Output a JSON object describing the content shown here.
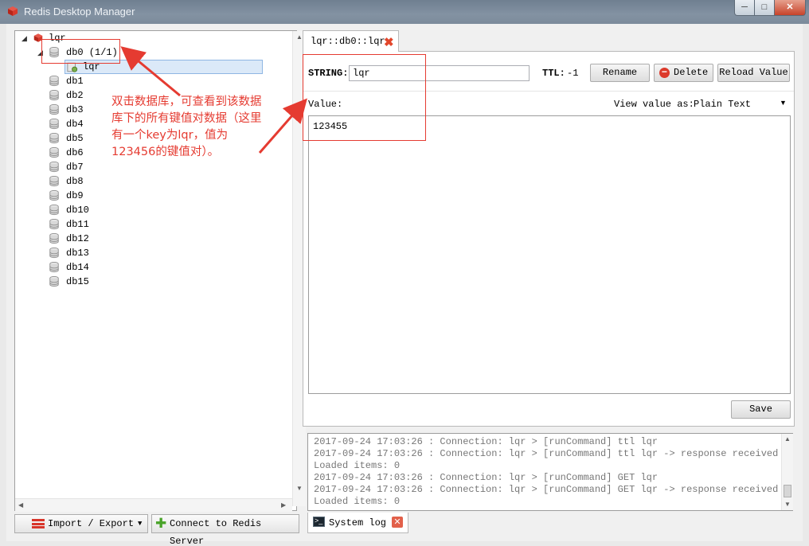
{
  "window": {
    "title": "Redis Desktop Manager",
    "controls": {
      "minimize": "─",
      "maximize": "□",
      "close": "✕"
    }
  },
  "tree": {
    "connection": {
      "label": "lqr",
      "icon": "redis-server-icon"
    },
    "databases": [
      {
        "label": "db0 (1/1)",
        "expanded": true,
        "keys": [
          {
            "label": "lqr",
            "selected": true
          }
        ]
      },
      {
        "label": "db1"
      },
      {
        "label": "db2"
      },
      {
        "label": "db3"
      },
      {
        "label": "db4"
      },
      {
        "label": "db5"
      },
      {
        "label": "db6"
      },
      {
        "label": "db7"
      },
      {
        "label": "db8"
      },
      {
        "label": "db9"
      },
      {
        "label": "db10"
      },
      {
        "label": "db11"
      },
      {
        "label": "db12"
      },
      {
        "label": "db13"
      },
      {
        "label": "db14"
      },
      {
        "label": "db15"
      }
    ]
  },
  "bottom_left": {
    "import_export_label": "Import / Export",
    "connect_label": "Connect to Redis Server"
  },
  "key_tab": {
    "label": "lqr::db0::lqr"
  },
  "key_view": {
    "type_label": "STRING:",
    "key_name": "lqr",
    "ttl_label": "TTL:",
    "ttl_value": "-1",
    "rename_label": "Rename",
    "delete_label": "Delete",
    "reload_label": "Reload Value",
    "value_label": "Value:",
    "view_as_label": "View value as:",
    "view_as_selected": "Plain Text",
    "value": "123455",
    "save_label": "Save"
  },
  "log": {
    "lines": [
      "2017-09-24 17:03:26 : Connection: lqr > [runCommand] ttl lqr",
      "2017-09-24 17:03:26 : Connection: lqr > [runCommand] ttl lqr -> response received :",
      "Loaded items: 0",
      "2017-09-24 17:03:26 : Connection: lqr > [runCommand] GET lqr",
      "2017-09-24 17:03:26 : Connection: lqr > [runCommand] GET lqr -> response received :",
      "Loaded items: 0"
    ],
    "tab_label": "System log"
  },
  "annotation": {
    "text": "双击数据库，可查看到该数据库下的所有键值对数据（这里有一个key为lqr，值为123456的键值对）。",
    "color": "#e53b31"
  },
  "colors": {
    "accent_red": "#e53b31",
    "selection": "#dbe9f8"
  }
}
